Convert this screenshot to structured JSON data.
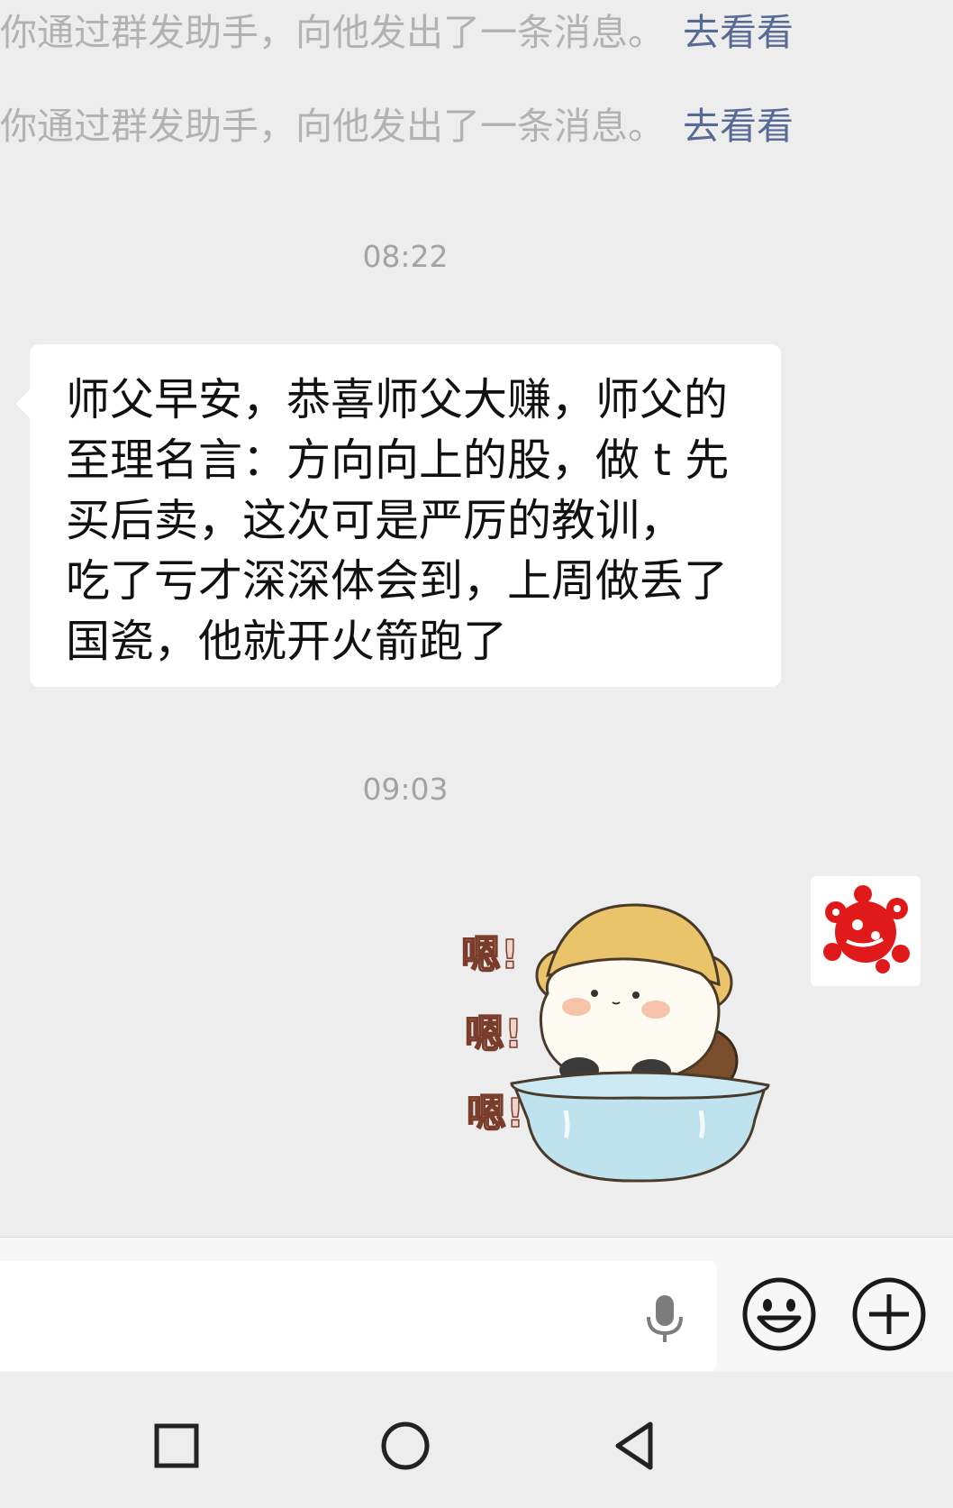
{
  "system_messages": [
    {
      "text": "你通过群发助手，向他发出了一条消息。",
      "link": "去看看"
    },
    {
      "text": "你通过群发助手，向他发出了一条消息。",
      "link": "去看看"
    }
  ],
  "timestamps": [
    "08:22",
    "09:03"
  ],
  "incoming_message": {
    "lines": [
      "师父早安，恭喜师父大赚，师父的",
      "至理名言：方向向上的股，做 t 先",
      "买后卖，这次可是严厉的教训，",
      "吃了亏才深深体会到，上周做丢了",
      "国瓷，他就开火箭跑了"
    ]
  },
  "sticker": {
    "text_lines": [
      "嗯!",
      "嗯!",
      "嗯!"
    ]
  },
  "input_bar": {
    "value": "",
    "icons": [
      "mic-icon",
      "emoji-icon",
      "plus-icon"
    ]
  },
  "nav_bar": {
    "icons": [
      "recents-square-icon",
      "home-circle-icon",
      "back-triangle-icon"
    ]
  },
  "colors": {
    "background": "#ededed",
    "link": "#576b95",
    "system_text": "#b2b2b2",
    "papercut_red": "#e0191b"
  }
}
